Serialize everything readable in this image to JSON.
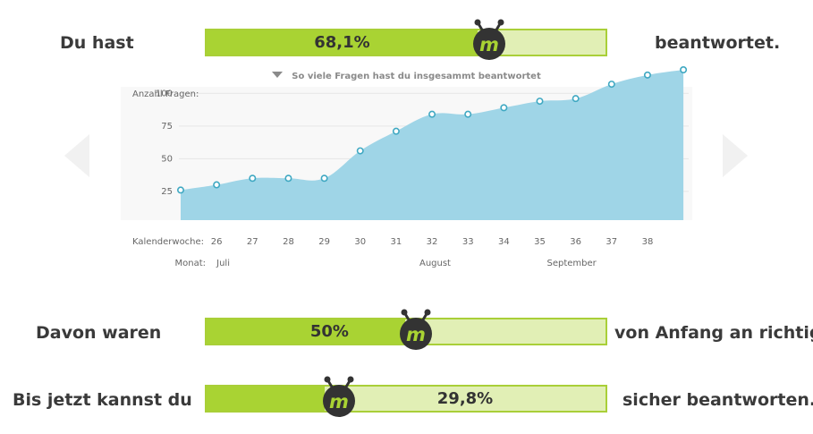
{
  "rows": [
    {
      "left_text": "Du hast",
      "percent_label": "68,1%",
      "percent": 68.1,
      "right_text": "beantwortet."
    },
    {
      "left_text": "Davon waren",
      "percent_label": "50%",
      "percent": 50,
      "right_text": "von Anfang an richtig."
    },
    {
      "left_text": "Bis jetzt kannst du",
      "percent_label": "29,8%",
      "percent": 29.8,
      "right_text": "sicher beantworten."
    }
  ],
  "caption": "So viele Fragen hast du insgesammt beantwortet",
  "icons": {
    "mascot": "m-robot-mascot-icon",
    "caption_marker": "triangle-down-icon",
    "prev": "arrow-left-icon",
    "next": "arrow-right-icon"
  },
  "colors": {
    "bar_fill": "#a9d333",
    "bar_bg": "#e1efb5",
    "bar_border": "#a9cf38",
    "area": "#9fd5e7",
    "point": "#3fa8c2",
    "mascot": "#333333"
  },
  "chart_data": {
    "type": "area",
    "ylabel": "Anzahl Fragen:",
    "yticks": [
      25,
      50,
      75,
      100
    ],
    "ylim": [
      3,
      105
    ],
    "xlabel": "Kalenderwoche:",
    "x": [
      25,
      26,
      27,
      28,
      29,
      30,
      31,
      32,
      33,
      34,
      35,
      36,
      37,
      38,
      39
    ],
    "x_tick_labels": [
      "26",
      "27",
      "28",
      "29",
      "30",
      "31",
      "32",
      "33",
      "34",
      "35",
      "36",
      "37",
      "38"
    ],
    "values": [
      26,
      30,
      35,
      35,
      35,
      56,
      71,
      84,
      84,
      89,
      94,
      96,
      107,
      114,
      118
    ],
    "month_label": "Monat:",
    "months": [
      {
        "name": "Juli",
        "week": 26
      },
      {
        "name": "August",
        "week": 31.65
      },
      {
        "name": "September",
        "week": 35.2
      }
    ],
    "grid": true,
    "marker": "circle"
  }
}
